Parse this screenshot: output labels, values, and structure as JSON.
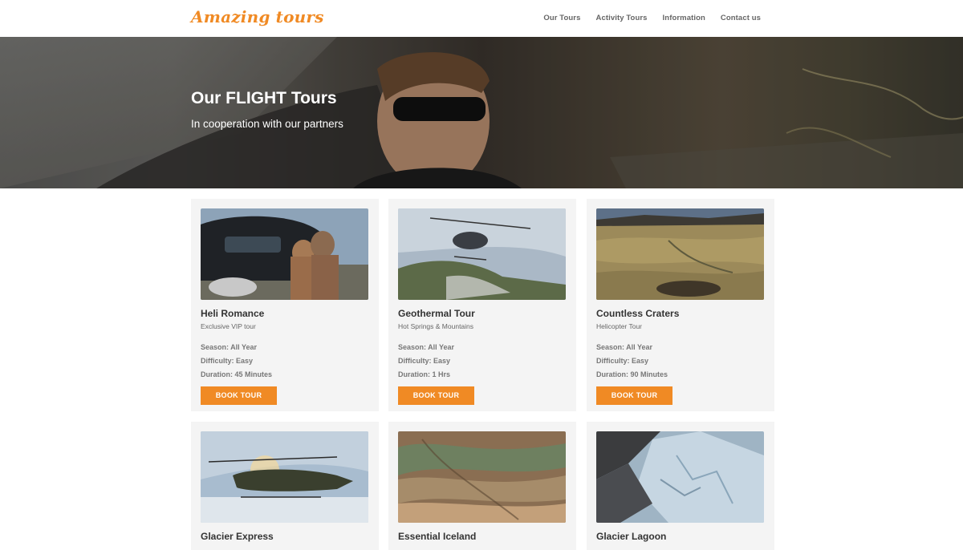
{
  "brand": {
    "logo": "Amazing tours",
    "accent": "#f08a24"
  },
  "nav": {
    "items": [
      "Our Tours",
      "Activity Tours",
      "Information",
      "Contact us"
    ]
  },
  "hero": {
    "title": "Our FLIGHT Tours",
    "subtitle": "In cooperation with our partners"
  },
  "tours": [
    {
      "title": "Heli Romance",
      "subtitle": "Exclusive VIP tour",
      "season": "Season: All Year",
      "difficulty": "Difficulty: Easy",
      "duration": "Duration: 45 Minutes",
      "button": "BOOK TOUR",
      "image": "helicopter-couple-champagne"
    },
    {
      "title": "Geothermal Tour",
      "subtitle": "Hot Springs & Mountains",
      "season": "Season: All Year",
      "difficulty": "Difficulty: Easy",
      "duration": "Duration: 1 Hrs",
      "button": "BOOK TOUR",
      "image": "helicopter-over-geothermal"
    },
    {
      "title": "Countless Craters",
      "subtitle": "Helicopter Tour",
      "season": "Season: All Year",
      "difficulty": "Difficulty: Easy",
      "duration": "Duration:  90 Minutes",
      "button": "BOOK TOUR",
      "image": "crater-landscape"
    },
    {
      "title": "Glacier Express",
      "image": "helicopter-on-glacier"
    },
    {
      "title": "Essential Iceland",
      "image": "colorful-mountains"
    },
    {
      "title": "Glacier Lagoon",
      "image": "glacier-ice"
    }
  ]
}
